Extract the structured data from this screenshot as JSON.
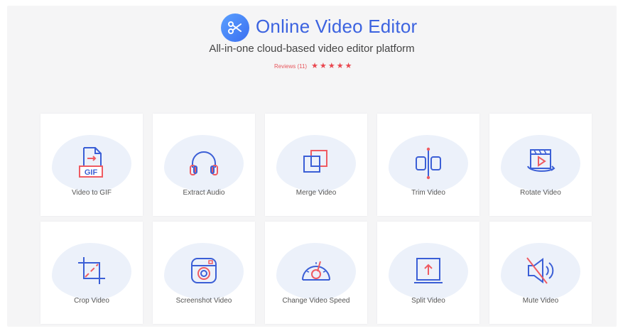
{
  "header": {
    "logo_icon": "scissors-icon",
    "title": "Online Video Editor",
    "subtitle": "All-in-one cloud-based video editor platform",
    "reviews_label": "Reviews (11)",
    "rating": 5
  },
  "colors": {
    "accent": "#3c63e0",
    "icon_stroke": "#3b5fd6",
    "icon_accent": "#ef5b62",
    "stars": "#e9464e"
  },
  "tools": [
    {
      "label": "Video to GIF",
      "icon": "gif-file-icon"
    },
    {
      "label": "Extract Audio",
      "icon": "headphones-icon"
    },
    {
      "label": "Merge Video",
      "icon": "merge-squares-icon"
    },
    {
      "label": "Trim Video",
      "icon": "trim-icon"
    },
    {
      "label": "Rotate Video",
      "icon": "rotate-video-icon"
    },
    {
      "label": "Crop Video",
      "icon": "crop-icon"
    },
    {
      "label": "Screenshot Video",
      "icon": "camera-icon"
    },
    {
      "label": "Change Video Speed",
      "icon": "speedometer-icon"
    },
    {
      "label": "Split Video",
      "icon": "split-screen-icon"
    },
    {
      "label": "Mute Video",
      "icon": "mute-speaker-icon"
    }
  ]
}
